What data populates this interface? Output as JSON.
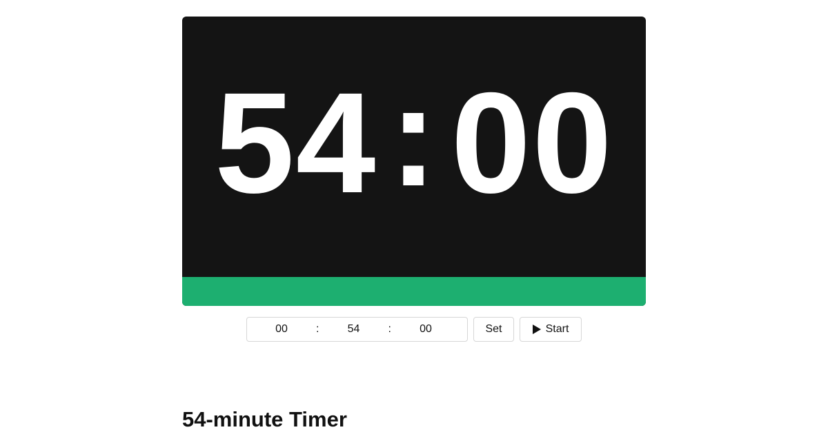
{
  "timer": {
    "minutes": "54",
    "colon": ":",
    "seconds": "00",
    "progress_fraction": 1.0,
    "progress_color": "#1daf70",
    "panel_color": "#141414"
  },
  "controls": {
    "hours_value": "00",
    "minutes_value": "54",
    "seconds_value": "00",
    "separator": ":",
    "set_label": "Set",
    "start_label": "Start",
    "start_icon": "play-icon"
  },
  "page": {
    "heading": "54-minute Timer"
  }
}
